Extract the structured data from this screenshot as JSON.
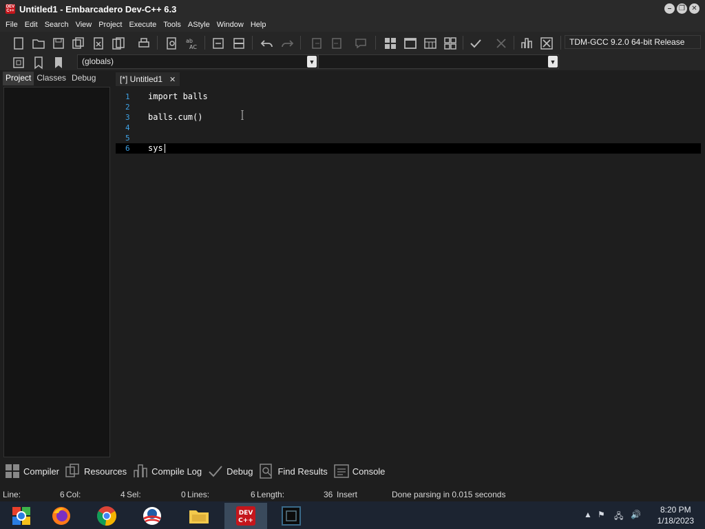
{
  "window": {
    "title": "Untitled1 - Embarcadero Dev-C++ 6.3",
    "app_icon_text": "DEV C++"
  },
  "menu": [
    "File",
    "Edit",
    "Search",
    "View",
    "Project",
    "Execute",
    "Tools",
    "AStyle",
    "Window",
    "Help"
  ],
  "toolbar": {
    "compiler": "TDM-GCC 9.2.0 64-bit Release",
    "scope_combo": "(globals)",
    "function_combo": ""
  },
  "left_tabs": [
    "Project",
    "Classes",
    "Debug"
  ],
  "editor": {
    "tab_label": "[*] Untitled1",
    "lines": [
      {
        "num": "1",
        "text": "import balls"
      },
      {
        "num": "2",
        "text": ""
      },
      {
        "num": "3",
        "text": "balls.cum()"
      },
      {
        "num": "4",
        "text": ""
      },
      {
        "num": "5",
        "text": ""
      },
      {
        "num": "6",
        "text": "sys"
      }
    ]
  },
  "bottom_tabs": [
    "Compiler",
    "Resources",
    "Compile Log",
    "Debug",
    "Find Results",
    "Console"
  ],
  "status": {
    "line_label": "Line:",
    "line_value": "6",
    "col_label": "Col:",
    "col_value": "4",
    "sel_label": "Sel:",
    "sel_value": "0",
    "lines_label": "Lines:",
    "lines_value": "6",
    "length_label": "Length:",
    "length_value": "36",
    "mode": "Insert",
    "message": "Done parsing in 0.015 seconds"
  },
  "taskbar": {
    "time": "8:20 PM",
    "date": "1/18/2023"
  },
  "colors": {
    "background": "#1e1e1e",
    "line_numbers": "#3fa2e6",
    "taskbar": "#1c2431"
  }
}
